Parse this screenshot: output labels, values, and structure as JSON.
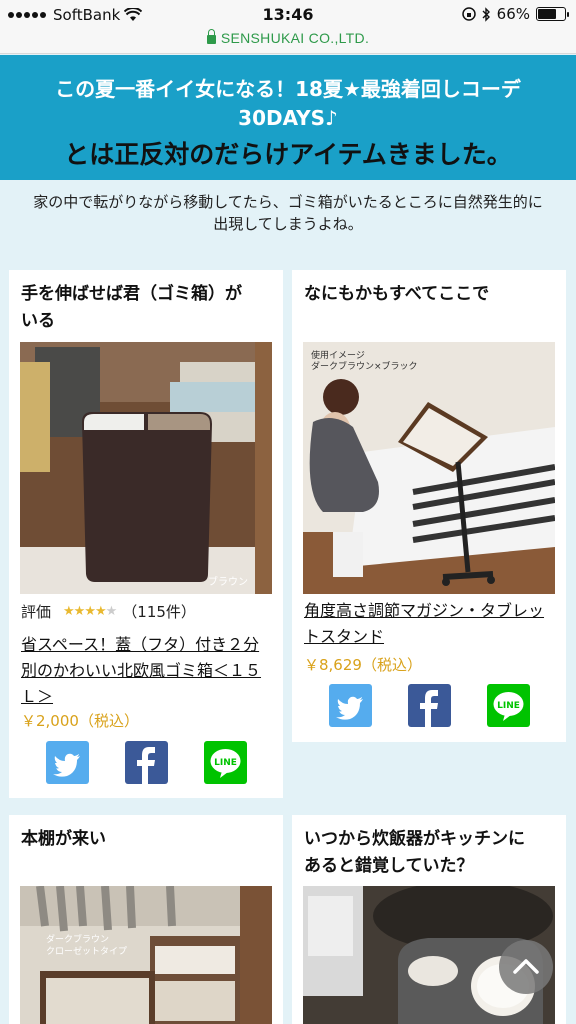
{
  "status_bar": {
    "carrier": "SoftBank",
    "time": "13:46",
    "battery": "66%"
  },
  "url_bar": {
    "domain": "SENSHUKAI CO.,LTD."
  },
  "banner": {
    "line1": "この夏一番イイ女になる！18夏★最強着回しコーデ",
    "line2": "30DAYS♪",
    "line3": "とは正反対のだらけアイテムきました。"
  },
  "intro": {
    "line1": "家の中で転がりながら移動してたら、ゴミ箱がいたるところに自然発生的に",
    "line2": "出現してしまうよね。"
  },
  "cards": [
    {
      "title_line1": "手を伸ばせば君（ゴミ箱）が",
      "title_line2": "いる",
      "photo_caption": "ブラウン",
      "rating_label": "評価",
      "rating": 4,
      "rating_count": "（115件）",
      "link_line1": "省スペース！蓋（フタ）付き２分",
      "link_line2": "別のかわいい北欧風ゴミ箱＜１５",
      "link_line3": "Ｌ＞",
      "price": "￥2,000（税込）"
    },
    {
      "title_line1": "なにもかもすべてここで",
      "photo_caption1": "使用イメージ",
      "photo_caption2": "ダークブラウン×ブラック",
      "link_line1": "角度高さ調節マガジン・タブレッ",
      "link_line2": "トスタンド",
      "price": "￥8,629（税込）"
    },
    {
      "title_line1": "本棚が来い",
      "photo_caption1": "ダークブラウン",
      "photo_caption2": "クローゼットタイプ"
    },
    {
      "title_line1": "いつから炊飯器がキッチンに",
      "title_line2": "あると錯覚していた？"
    }
  ],
  "icons": {
    "share_buttons": [
      "twitter-icon",
      "facebook-icon",
      "line-icon"
    ],
    "scroll_top": "chevron-up-icon"
  },
  "colors": {
    "banner": "#1aa0c8",
    "background": "#e3f2f7",
    "price": "#d9a21b",
    "twitter": "#55acee",
    "facebook": "#3b5998",
    "line": "#00c300",
    "secure": "#2e9a4a"
  }
}
